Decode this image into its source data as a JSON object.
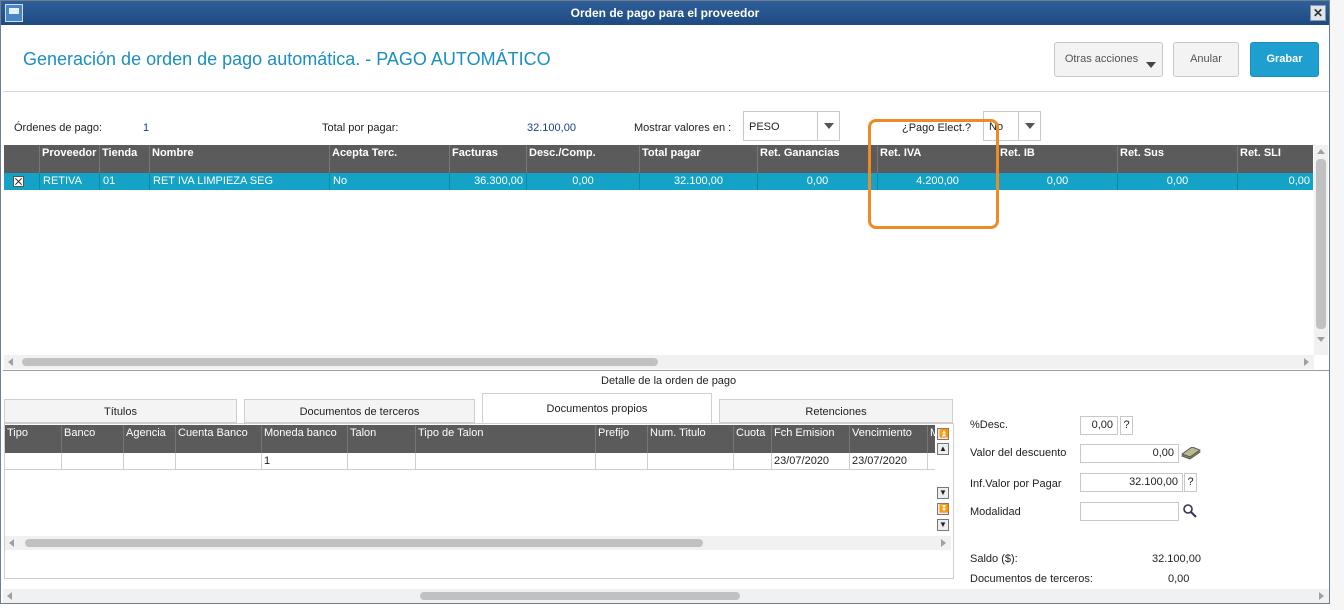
{
  "window": {
    "title": "Orden de pago para el proveedor",
    "close": "✕"
  },
  "header": {
    "title": "Generación de orden de pago automática. - PAGO AUTOMÁTICO",
    "buttons": {
      "otras": "Otras acciones",
      "anular": "Anular",
      "grabar": "Grabar"
    }
  },
  "summary": {
    "ordenes_label": "Órdenes de pago:",
    "ordenes_value": "1",
    "total_label": "Total por pagar:",
    "total_value": "32.100,00",
    "mostrar_label": "Mostrar valores en :",
    "mostrar_value": "PESO",
    "pago_elect_label": "¿Pago Elect.?",
    "pago_elect_value": "No"
  },
  "grid": {
    "columns": [
      "Proveedor",
      "Tienda",
      "Nombre",
      "Acepta Terc.",
      "Facturas",
      "Desc./Comp.",
      "Total pagar",
      "Ret. Ganancias",
      "Ret. IVA",
      "Ret. IB",
      "Ret. Sus",
      "Ret. SLI"
    ],
    "row": [
      "RETIVA",
      "01",
      "RET IVA LIMPIEZA SEG",
      "No",
      "36.300,00",
      "0,00",
      "32.100,00",
      "0,00",
      "4.200,00",
      "0,00",
      "0,00",
      "0,00"
    ]
  },
  "detail": {
    "title": "Detalle de la orden de pago",
    "tabs": [
      "Títulos",
      "Documentos de terceros",
      "Documentos propios",
      "Retenciones"
    ],
    "active_tab": "Documentos propios",
    "columns": [
      "Tipo",
      "Banco",
      "Agencia",
      "Cuenta Banco",
      "Moneda banco",
      "Talon",
      "Tipo de Talon",
      "Prefijo",
      "Num. Titulo",
      "Cuota",
      "Fch Emision",
      "Vencimiento",
      "M"
    ],
    "row": [
      "",
      "",
      "",
      "",
      "1",
      "",
      "",
      "",
      "",
      "",
      "23/07/2020",
      "23/07/2020",
      ""
    ]
  },
  "side": {
    "desc_label": "%Desc.",
    "desc_value": "0,00",
    "valor_desc_label": "Valor del descuento",
    "valor_desc_value": "0,00",
    "inf_label": "Inf.Valor por Pagar",
    "inf_value": "32.100,00",
    "modalidad_label": "Modalidad",
    "modalidad_value": "",
    "saldo_label": "Saldo ($):",
    "saldo_value": "32.100,00",
    "doc_terc_label": "Documentos de terceros:",
    "doc_terc_value": "0,00",
    "help": "?"
  },
  "colors": {
    "accent": "#1e9fcf",
    "row_highlight": "#14a3c7",
    "callout": "#f08a24",
    "title_text": "#1a8fc0"
  }
}
